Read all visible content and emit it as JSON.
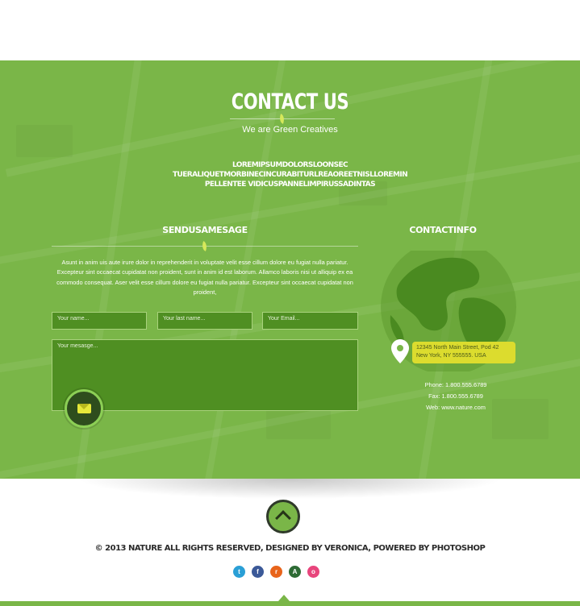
{
  "contact": {
    "title": "CONTACT US",
    "subtitle": "We are Green Creatives",
    "lorem_line1": "LOREMIPSUMDOLORSLOONSEC TUERALIQUETMORBINECINCURABITURLREAOREETNISLLOREMIN",
    "lorem_line2": "PELLENTEE VIDICUSPANNELIMPIRUSSADINTAS"
  },
  "form": {
    "heading": "SENDUSAMESAGE",
    "description": "Asunt in anim uis aute irure dolor in reprehenderit in voluptate velit esse cillum dolore eu fugiat nulla pariatur. Excepteur sint occaecat cupidatat non proident, sunt in anim id est laborum. Allamco laboris nisi ut alliquip ex ea commodo consequat. Aser velit esse cillum dolore eu fugiat nulla pariatur. Excepteur sint occaecat cupidatat non proident,",
    "name_placeholder": "Your name...",
    "lastname_placeholder": "Your last name...",
    "email_placeholder": "Your Email...",
    "message_placeholder": "Your mesasge..."
  },
  "info": {
    "heading": "CONTACTINFO",
    "address_line1": "12345 North Main Street, Pod 42",
    "address_line2": "New York, NY 555555. USA",
    "phone": "Phone: 1.800.555.6789",
    "fax": "Fax: 1.800.555.6789",
    "web": "Web: www.nature.com"
  },
  "footer": {
    "copyright": "© 2013 NATURE ALL RIGHTS RESERVED, DESIGNED BY VERONICA, POWERED BY PHOTOSHOP",
    "social": [
      {
        "name": "twitter-icon",
        "glyph": "t",
        "color": "#2a9fd6"
      },
      {
        "name": "facebook-icon",
        "glyph": "f",
        "color": "#3b5998"
      },
      {
        "name": "rss-icon",
        "glyph": "r",
        "color": "#e8641b"
      },
      {
        "name": "a-icon",
        "glyph": "A",
        "color": "#2e6b35"
      },
      {
        "name": "dribbble-icon",
        "glyph": "o",
        "color": "#e8457c"
      }
    ]
  },
  "colors": {
    "accent_green": "#7ab648",
    "field_green": "#4f8f22",
    "address_yellow": "#dcdc2e"
  }
}
